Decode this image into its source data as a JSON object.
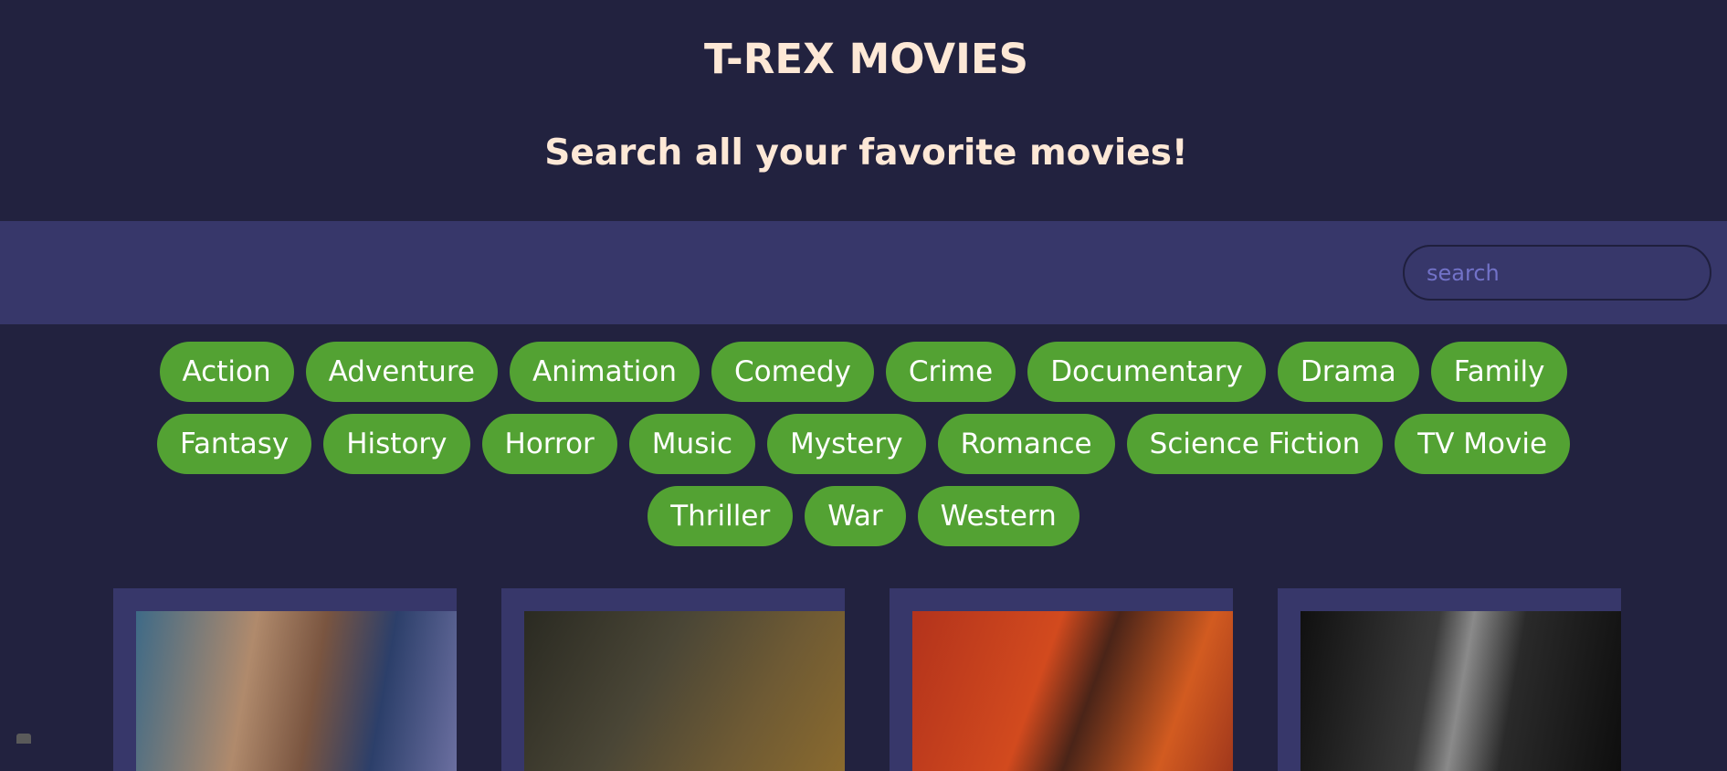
{
  "header": {
    "title": "T-REX MOVIES",
    "subtitle": "Search all your favorite movies!"
  },
  "search": {
    "placeholder": "search",
    "value": ""
  },
  "genres": {
    "rows": [
      [
        "Action",
        "Adventure",
        "Animation",
        "Comedy",
        "Crime",
        "Documentary",
        "Drama",
        "Family"
      ],
      [
        "Fantasy",
        "History",
        "Horror",
        "Music",
        "Mystery",
        "Romance",
        "Science Fiction",
        "TV Movie"
      ],
      [
        "Thriller",
        "War",
        "Western"
      ]
    ]
  },
  "colors": {
    "background": "#22223f",
    "search_bar": "#37376a",
    "title_text": "#fde8d6",
    "genre_pill": "#53a233",
    "card": "#37376a"
  },
  "movies": {
    "count_visible": 4
  }
}
